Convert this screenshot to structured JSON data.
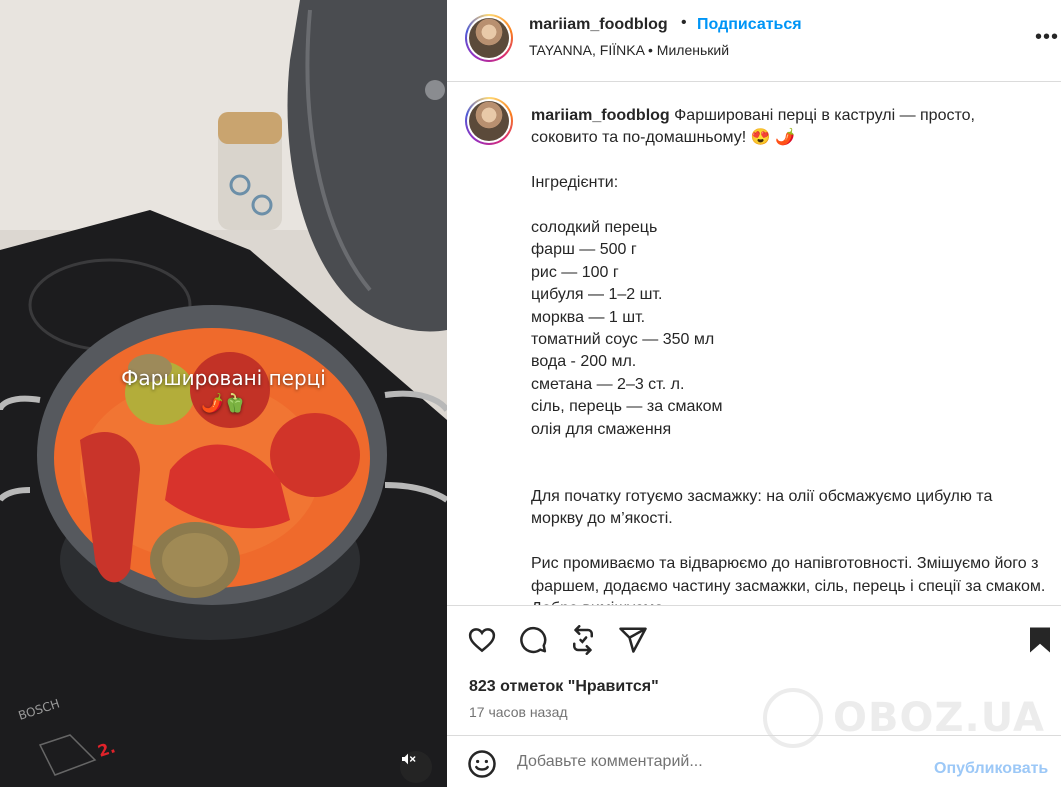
{
  "media": {
    "overlay_text": "Фаршировані перці",
    "overlay_emoji": "🌶️🫑",
    "brand_text": "BOSCH",
    "cooktop_level": "2.",
    "mute_icon": "speaker-muted-icon"
  },
  "header": {
    "username": "mariiam_foodblog",
    "separator": "•",
    "follow_label": "Подписаться",
    "audio": "TAYANNA, FIÏNKA • Миленький",
    "more_icon": "more-horizontal-icon",
    "more_label": "•••"
  },
  "caption": {
    "username": "mariiam_foodblog",
    "text": " Фаршировані перці в каструлі — просто, соковито та по-домашньому! 😍 🌶️\n\nІнгредієнти:\n\nсолодкий перець\nфарш — 500 г\nрис — 100 г\nцибуля — 1–2 шт.\nморква — 1 шт.\nтоматний соус — 350 мл\nвода - 200 мл.\nсметана — 2–3 ст. л.\nсіль, перець — за смаком\nолія для смаження\n\n\nДля початку готуємо засмажку: на олії обсмажуємо цибулю та моркву до м’якості.\n\nРис промиваємо та відварюємо до напівготовності. Змішуємо його з фаршем, додаємо частину засмажки, сіль, перець і спеції за смаком. Добре вимішуємо."
  },
  "actions": {
    "like_icon": "heart-icon",
    "comment_icon": "comment-icon",
    "repost_icon": "repost-icon",
    "share_icon": "share-icon",
    "save_icon": "bookmark-icon",
    "likes": "823 отметок \"Нравится\"",
    "time": "17 часов назад"
  },
  "watermark": {
    "text": "OBOZ.UA"
  },
  "comment": {
    "emoji_icon": "smiley-icon",
    "placeholder": "Добавьте комментарий...",
    "post_label": "Опубликовать"
  },
  "colors": {
    "link_blue": "#0095f6",
    "post_disabled": "#9cc8f7",
    "sauce": "#f0652a",
    "pepper_red": "#d8332c"
  }
}
